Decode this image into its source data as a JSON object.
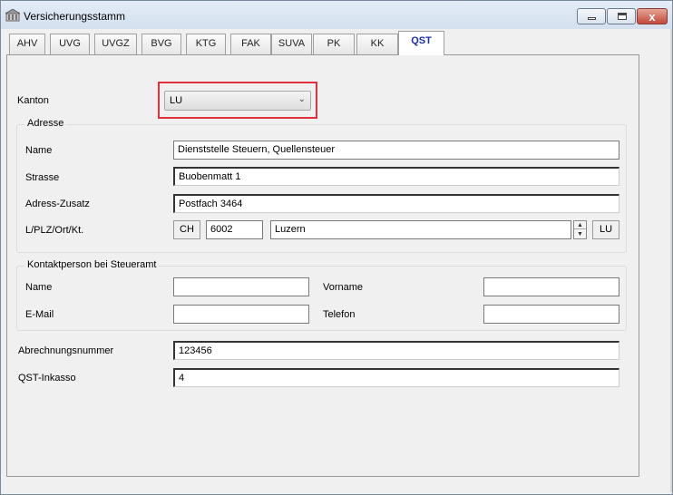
{
  "window": {
    "title": "Versicherungsstamm",
    "close_glyph": "x"
  },
  "tabs": [
    {
      "label": "AHV"
    },
    {
      "label": "UVG"
    },
    {
      "label": "UVGZ"
    },
    {
      "label": "BVG"
    },
    {
      "label": "KTG"
    },
    {
      "label": "FAK"
    },
    {
      "label": "SUVA"
    },
    {
      "label": "PK"
    },
    {
      "label": "KK"
    },
    {
      "label": "QST"
    }
  ],
  "active_tab": "QST",
  "kanton": {
    "label": "Kanton",
    "value": "LU"
  },
  "adresse": {
    "title": "Adresse",
    "name_label": "Name",
    "name": "Dienststelle Steuern, Quellensteuer",
    "strasse_label": "Strasse",
    "strasse": "Buobenmatt 1",
    "zusatz_label": "Adress-Zusatz",
    "zusatz": "Postfach 3464",
    "plz_label": "L/PLZ/Ort/Kt.",
    "land": "CH",
    "plz": "6002",
    "ort": "Luzern",
    "kt": "LU"
  },
  "kontakt": {
    "title": "Kontaktperson bei Steueramt",
    "name_label": "Name",
    "name": "",
    "vorname_label": "Vorname",
    "vorname": "",
    "email_label": "E-Mail",
    "email": "",
    "telefon_label": "Telefon",
    "telefon": ""
  },
  "abrechnung": {
    "label": "Abrechnungsnummer",
    "value": "123456"
  },
  "inkasso": {
    "label": "QST-Inkasso",
    "value": "4"
  },
  "icons": {
    "app": "app-icon",
    "dropdown": "chevron-down-icon"
  },
  "colors": {
    "active_tab_text": "#1c2fa8",
    "highlight_border": "#e0313c"
  }
}
